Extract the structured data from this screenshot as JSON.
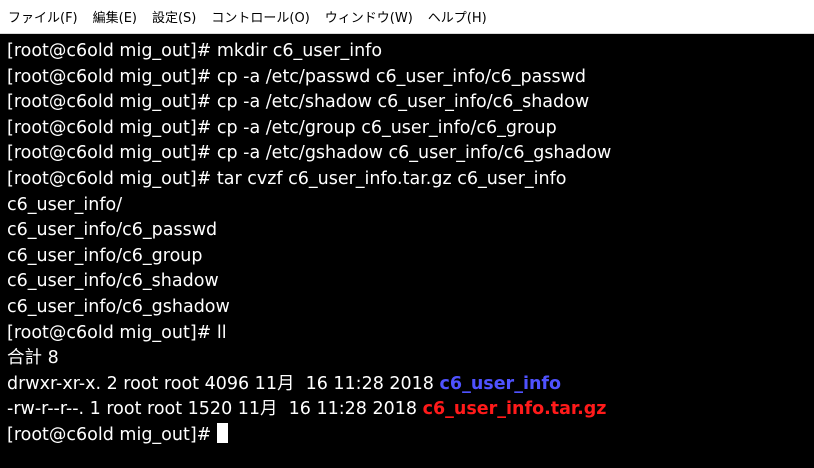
{
  "menubar": {
    "items": [
      {
        "label": "ファイル(F)"
      },
      {
        "label": "編集(E)"
      },
      {
        "label": "設定(S)"
      },
      {
        "label": "コントロール(O)"
      },
      {
        "label": "ウィンドウ(W)"
      },
      {
        "label": "ヘルプ(H)"
      }
    ]
  },
  "terminal": {
    "lines": [
      {
        "text": "[root@c6old mig_out]# mkdir c6_user_info"
      },
      {
        "text": "[root@c6old mig_out]# cp -a /etc/passwd c6_user_info/c6_passwd"
      },
      {
        "text": "[root@c6old mig_out]# cp -a /etc/shadow c6_user_info/c6_shadow"
      },
      {
        "text": "[root@c6old mig_out]# cp -a /etc/group c6_user_info/c6_group"
      },
      {
        "text": "[root@c6old mig_out]# cp -a /etc/gshadow c6_user_info/c6_gshadow"
      },
      {
        "text": "[root@c6old mig_out]# tar cvzf c6_user_info.tar.gz c6_user_info"
      },
      {
        "text": "c6_user_info/"
      },
      {
        "text": "c6_user_info/c6_passwd"
      },
      {
        "text": "c6_user_info/c6_group"
      },
      {
        "text": "c6_user_info/c6_shadow"
      },
      {
        "text": "c6_user_info/c6_gshadow"
      },
      {
        "text": "[root@c6old mig_out]# ll"
      },
      {
        "text": "合計 8"
      }
    ],
    "listing": [
      {
        "meta": "drwxr-xr-x. 2 root root 4096 11月  16 11:28 2018 ",
        "name": "c6_user_info"
      },
      {
        "meta": "-rw-r--r--. 1 root root 1520 11月  16 11:28 2018 ",
        "name": "c6_user_info.tar.gz"
      }
    ],
    "prompt": "[root@c6old mig_out]# ",
    "colors": {
      "background": "#000000",
      "foreground": "#ffffff",
      "directory": "#4f52ff",
      "archive": "#ff1a1a"
    }
  }
}
